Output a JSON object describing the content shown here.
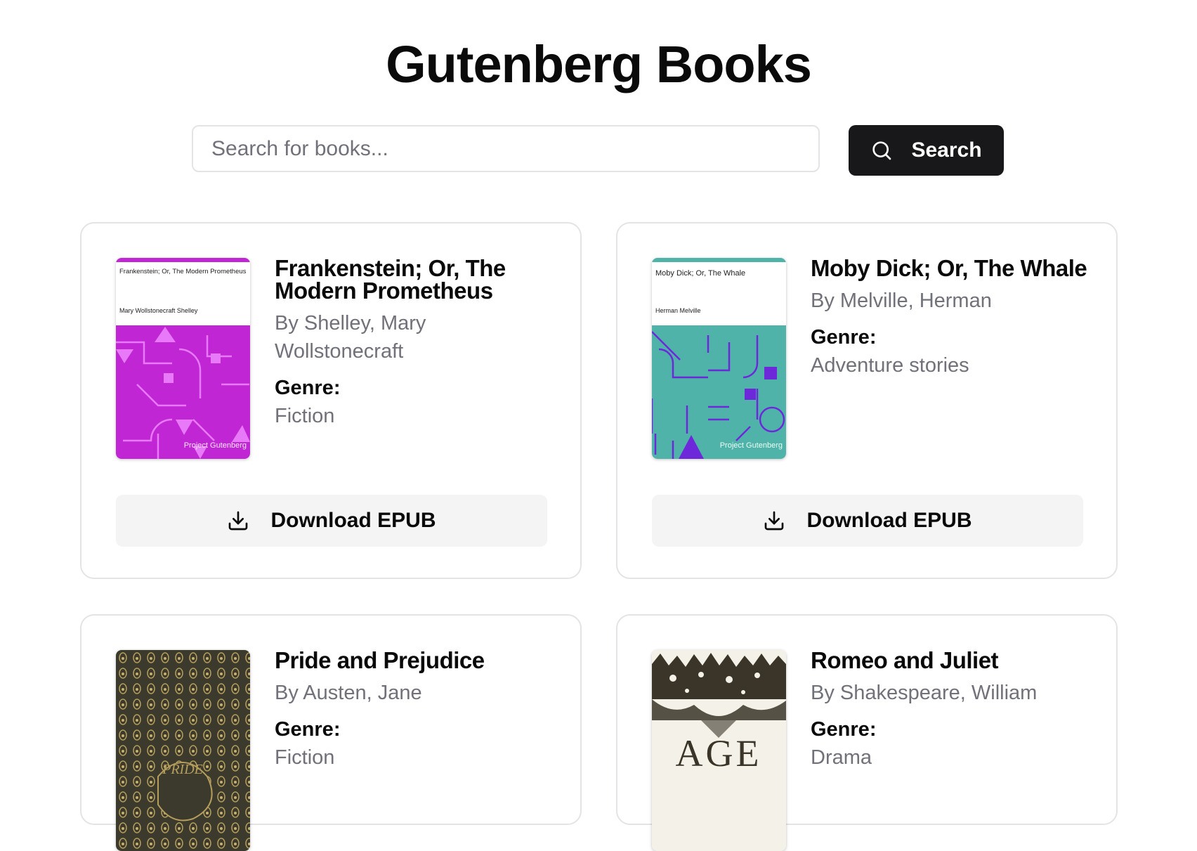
{
  "page": {
    "title": "Gutenberg Books"
  },
  "search": {
    "placeholder": "Search for books...",
    "value": "",
    "button_label": "Search",
    "icon": "search-icon"
  },
  "books": [
    {
      "title": "Frankenstein; Or, The Modern Prometheus",
      "author": "By Shelley, Mary Wollstonecraft",
      "genre_label": "Genre:",
      "genre": "Fiction",
      "download_label": "Download EPUB",
      "cover": {
        "title": "Frankenstein; Or, The Modern Prometheus",
        "author": "Mary Wollstonecraft Shelley",
        "publisher": "Project Gutenberg",
        "color": "#c026d3",
        "shape_color": "#e879f9"
      }
    },
    {
      "title": "Moby Dick; Or, The Whale",
      "author": "By Melville, Herman",
      "genre_label": "Genre:",
      "genre": "Adventure stories",
      "download_label": "Download EPUB",
      "cover": {
        "title": "Moby Dick; Or, The Whale",
        "author": "Herman Melville",
        "publisher": "Project Gutenberg",
        "color": "#4fb3a9",
        "shape_color": "#6d28d9"
      }
    },
    {
      "title": "Pride and Prejudice",
      "author": "By Austen, Jane",
      "genre_label": "Genre:",
      "genre": "Fiction",
      "cover": {
        "color": "#3b3a2c",
        "accent": "#b59d5c",
        "word": "PRIDE"
      }
    },
    {
      "title": "Romeo and Juliet",
      "author": "By Shakespeare, William",
      "genre_label": "Genre:",
      "genre": "Drama",
      "cover": {
        "color": "#f4f1e8",
        "accent": "#3a3528",
        "word": "AGE"
      }
    }
  ]
}
